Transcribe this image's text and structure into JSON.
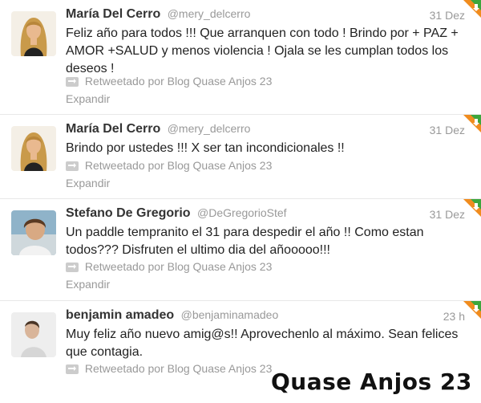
{
  "tweets": [
    {
      "name": "María Del Cerro",
      "handle": "@mery_delcerro",
      "time": "31 Dez",
      "text": "Feliz año para todos !!! Que arranquen con todo ! Brindo por + PAZ + AMOR +SALUD y menos violencia ! Ojala se les cumplan todos los deseos !",
      "retweet": "Retweetado por Blog Quase Anjos 23",
      "expand": "Expandir",
      "avatar": "woman-blonde-avatar"
    },
    {
      "name": "María Del Cerro",
      "handle": "@mery_delcerro",
      "time": "31 Dez",
      "text": "Brindo por ustedes !!! X ser tan incondicionales !!",
      "retweet": "Retweetado por Blog Quase Anjos 23",
      "expand": "Expandir",
      "avatar": "woman-blonde-avatar"
    },
    {
      "name": "Stefano De Gregorio",
      "handle": "@DeGregorioStef",
      "time": "31 Dez",
      "text": "Un paddle tempranito el 31 para despedir el año !! Como estan todos??? Disfruten el ultimo dia del añooooo!!!",
      "retweet": "Retweetado por Blog Quase Anjos 23",
      "expand": "Expandir",
      "avatar": "man-curly-hair-avatar"
    },
    {
      "name": "benjamin amadeo",
      "handle": "@benjaminamadeo",
      "time": "23 h",
      "text": "Muy feliz año nuevo amig@s!! Aprovechenlo al máximo. Sean felices que contagia.",
      "retweet": "Retweetado por Blog Quase Anjos 23",
      "expand": "",
      "avatar": "man-profile-avatar"
    }
  ],
  "watermark": "Quase Anjos 23",
  "colors": {
    "name": "#333333",
    "muted": "#999999",
    "text": "#222222",
    "divider": "#e8e8e8",
    "corner_green": "#3da63d",
    "corner_orange": "#f08c1e"
  },
  "icons": {
    "retweet": "retweet-icon",
    "corner": "retweet-corner-badge-icon"
  }
}
